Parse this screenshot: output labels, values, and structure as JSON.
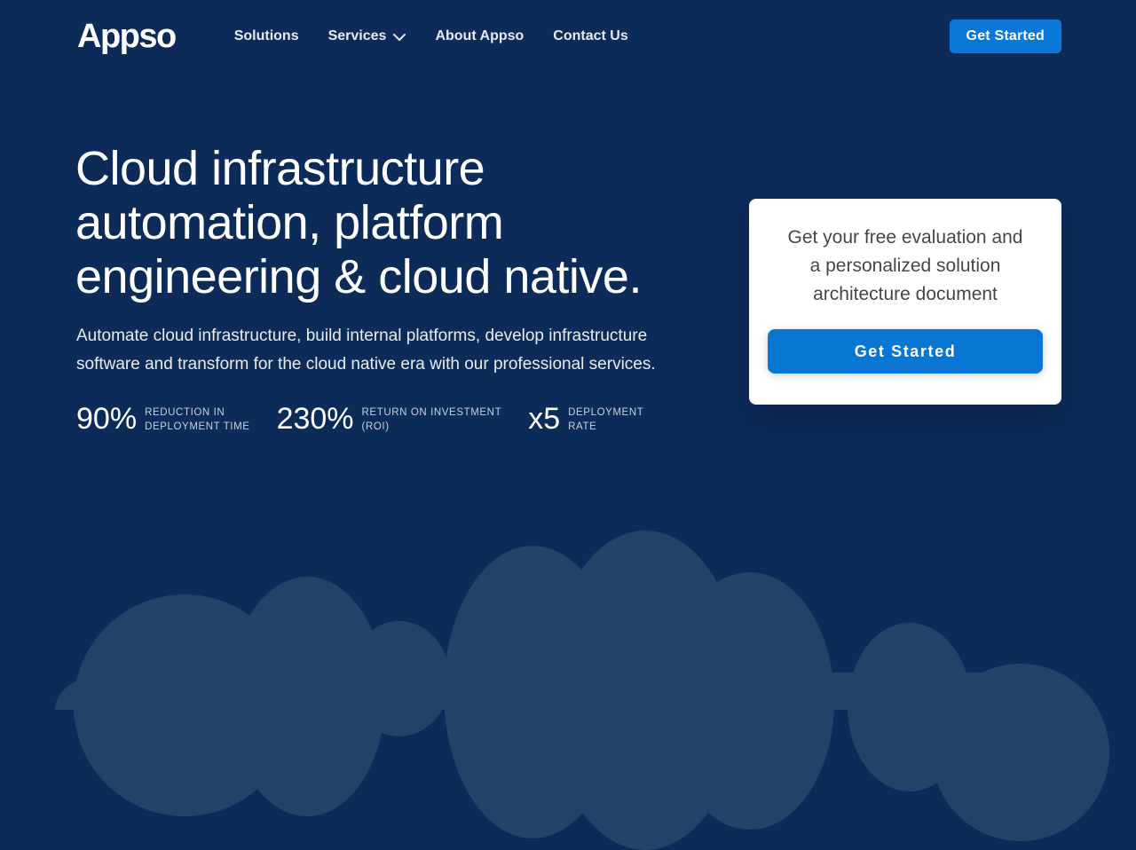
{
  "colors": {
    "background_navy": "#0d2b59",
    "cloud_navy": "#214367",
    "accent_blue": "#0b77d6",
    "card_background": "#ffffff",
    "card_text_gray": "#42474e"
  },
  "header": {
    "logo_text": "Appso",
    "nav_items": [
      {
        "label": "Solutions"
      },
      {
        "label": "Services",
        "icon": "chevron-down-icon"
      },
      {
        "label": "About Appso"
      },
      {
        "label": "Contact Us"
      }
    ],
    "cta_label": "Get Started"
  },
  "hero": {
    "title": "Cloud infrastructure automation, platform engineering & cloud native.",
    "title_lines": [
      "Cloud infrastructure",
      "automation, platform",
      "engineering & cloud native."
    ],
    "subtitle": "Automate cloud infrastructure, build internal platforms, develop infrastructure software and transform for the cloud native era with our professional services.",
    "stats": [
      {
        "value": "90%",
        "label_line1": "REDUCTION IN",
        "label_line2": "DEPLOYMENT TIME"
      },
      {
        "value": "230%",
        "label_line1": "RETURN ON INVESTMENT",
        "label_line2": "(ROI)"
      },
      {
        "value": "x5",
        "label_line1": "DEPLOYMENT",
        "label_line2": "RATE"
      }
    ]
  },
  "cta_card": {
    "text": "Get your free evaluation and a personalized solution architecture document",
    "text_lines": [
      "Get your free evaluation and",
      "a personalized solution",
      "architecture document"
    ],
    "button_label": "Get Started"
  }
}
